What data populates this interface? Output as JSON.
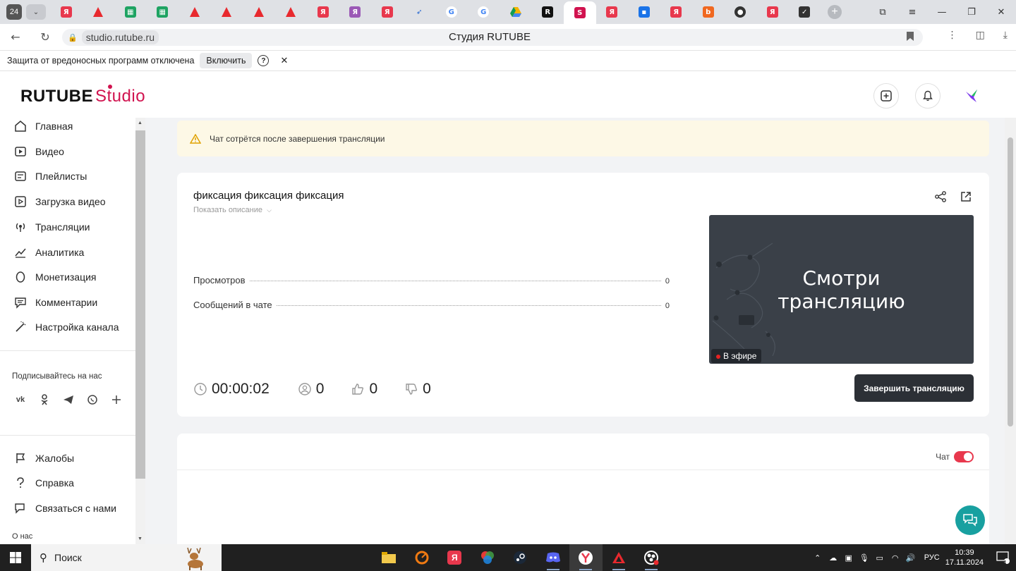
{
  "browser": {
    "tab_count": "24",
    "tab_labels": [
      "Я",
      "Я",
      "Я",
      "Я",
      "Я",
      "Я",
      "Я",
      "Я",
      "Я"
    ],
    "url": "studio.rutube.ru",
    "page_title": "Студия RUTUBE"
  },
  "protection_bar": {
    "message": "Защита от вредоносных программ отключена",
    "enable_label": "Включить",
    "help_label": "?"
  },
  "header": {
    "logo_main": "RUTUBE",
    "logo_studio": "Studio"
  },
  "sidebar": {
    "items": [
      {
        "label": "Главная",
        "icon": "home-icon"
      },
      {
        "label": "Видео",
        "icon": "video-icon"
      },
      {
        "label": "Плейлисты",
        "icon": "playlist-icon"
      },
      {
        "label": "Загрузка видео",
        "icon": "upload-icon"
      },
      {
        "label": "Трансляции",
        "icon": "broadcast-icon"
      },
      {
        "label": "Аналитика",
        "icon": "analytics-icon"
      },
      {
        "label": "Монетизация",
        "icon": "monetization-icon"
      },
      {
        "label": "Комментарии",
        "icon": "comments-icon"
      },
      {
        "label": "Настройка канала",
        "icon": "channel-settings-icon"
      }
    ],
    "subscribe_label": "Подписывайтесь на нас",
    "social": [
      "vk-icon",
      "ok-icon",
      "telegram-icon",
      "viber-icon",
      "more-icon"
    ],
    "bottom_items": [
      {
        "label": "Жалобы",
        "icon": "flag-icon"
      },
      {
        "label": "Справка",
        "icon": "help-icon"
      },
      {
        "label": "Связаться с нами",
        "icon": "contact-icon"
      }
    ],
    "about_label": "О нас"
  },
  "main": {
    "warning": "Чат сотрётся после завершения трансляции",
    "stream": {
      "title": "фиксация фиксация фиксация",
      "show_description": "Показать описание",
      "stats": [
        {
          "label": "Просмотров",
          "value": "0"
        },
        {
          "label": "Сообщений в чате",
          "value": "0"
        }
      ],
      "preview_text_line1": "Смотри",
      "preview_text_line2": "трансляцию",
      "live_badge": "В эфире",
      "duration": "00:00:02",
      "viewers": "0",
      "likes": "0",
      "dislikes": "0",
      "end_button": "Завершить трансляцию"
    },
    "chat": {
      "label": "Чат",
      "enabled": true
    }
  },
  "taskbar": {
    "search_placeholder": "Поиск",
    "language": "РУС",
    "time": "10:39",
    "date": "17.11.2024",
    "notifications": "4"
  },
  "colors": {
    "brand": "#d1134f",
    "live_dot": "#e52222",
    "toggle_on": "#e8384d",
    "support_fab": "#18a0a0",
    "end_button_bg": "#2c3036"
  }
}
